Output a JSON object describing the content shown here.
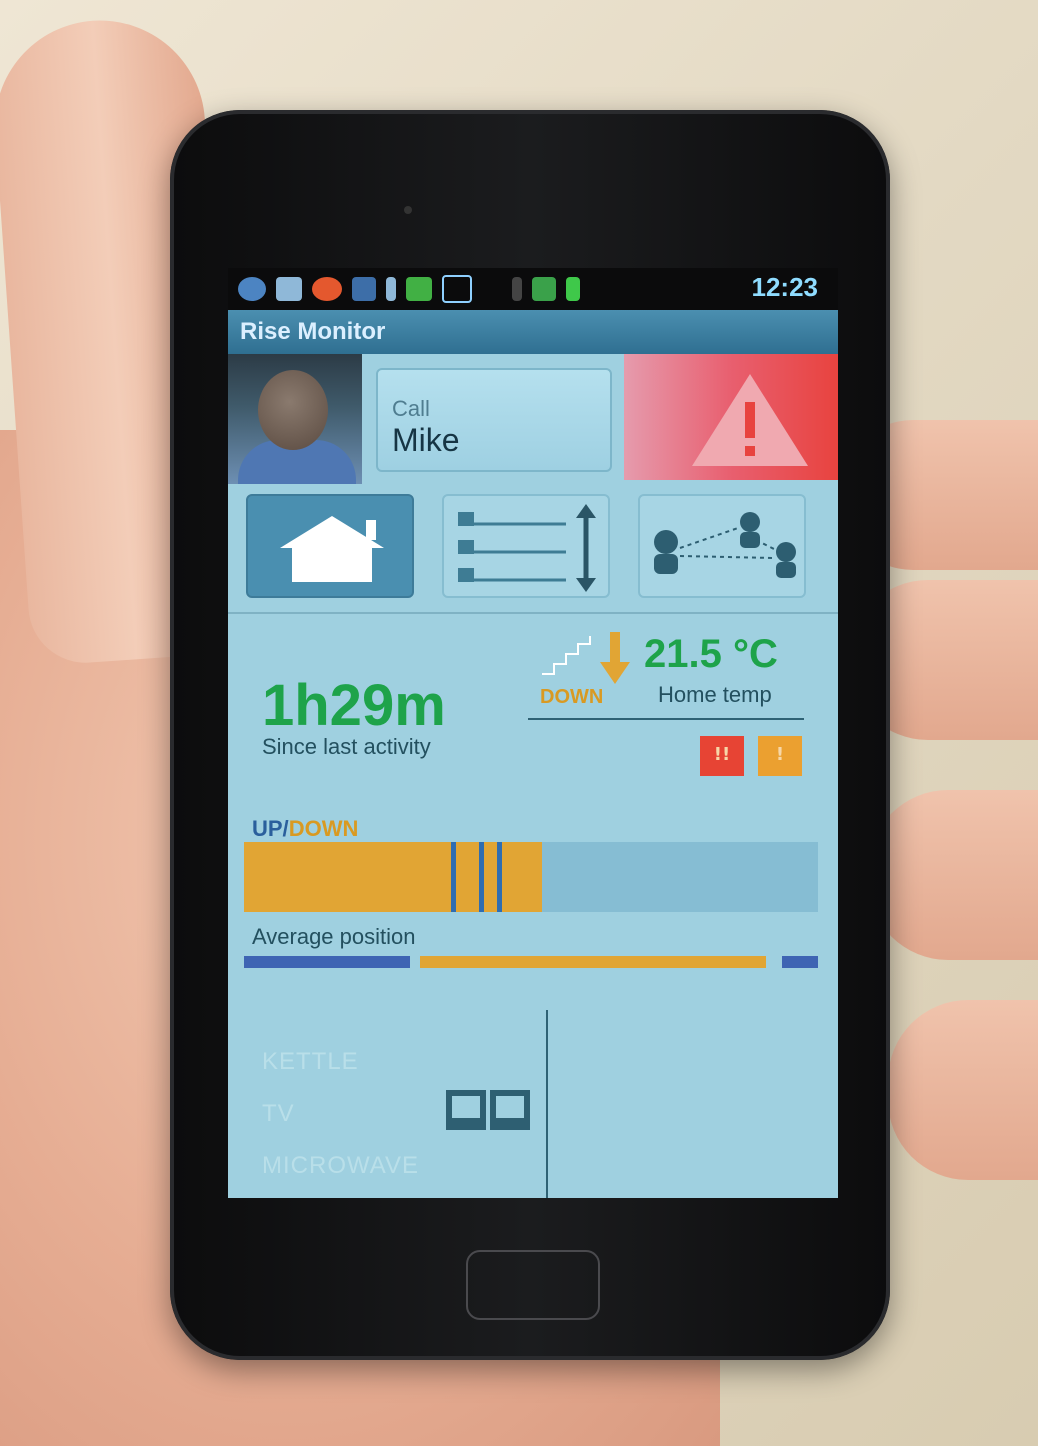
{
  "status_bar": {
    "clock": "12:23",
    "icons": [
      "notification-badge-icon",
      "email-icon",
      "app-badge-icon",
      "hat-icon",
      "download-icon",
      "storage-icon",
      "shield-icon",
      "vibrate-icon",
      "signal-icon",
      "battery-icon"
    ]
  },
  "app": {
    "title": "Rise Monitor"
  },
  "top_row": {
    "call_label": "Call",
    "call_name": "Mike"
  },
  "status": {
    "since_value": "1h29m",
    "since_label": "Since last activity",
    "direction": "DOWN",
    "temp_value": "21.5 °C",
    "temp_label": "Home temp",
    "mini_red_glyph": "!!",
    "mini_orange_glyph": "!"
  },
  "updown": {
    "label_up": "UP/",
    "label_down": "DOWN",
    "down_fraction": 0.52,
    "up_marks": [
      0.36,
      0.41,
      0.44
    ]
  },
  "average": {
    "label": "Average position"
  },
  "appliances": {
    "items": [
      "KETTLE",
      "TV",
      "MICROWAVE"
    ]
  },
  "colors": {
    "screen_bg": "#9fd0e0",
    "title_blue": "#2f6f91",
    "green": "#1ea34a",
    "orange": "#e1a534",
    "blue": "#2f6db1",
    "alert_red": "#e8433f"
  }
}
